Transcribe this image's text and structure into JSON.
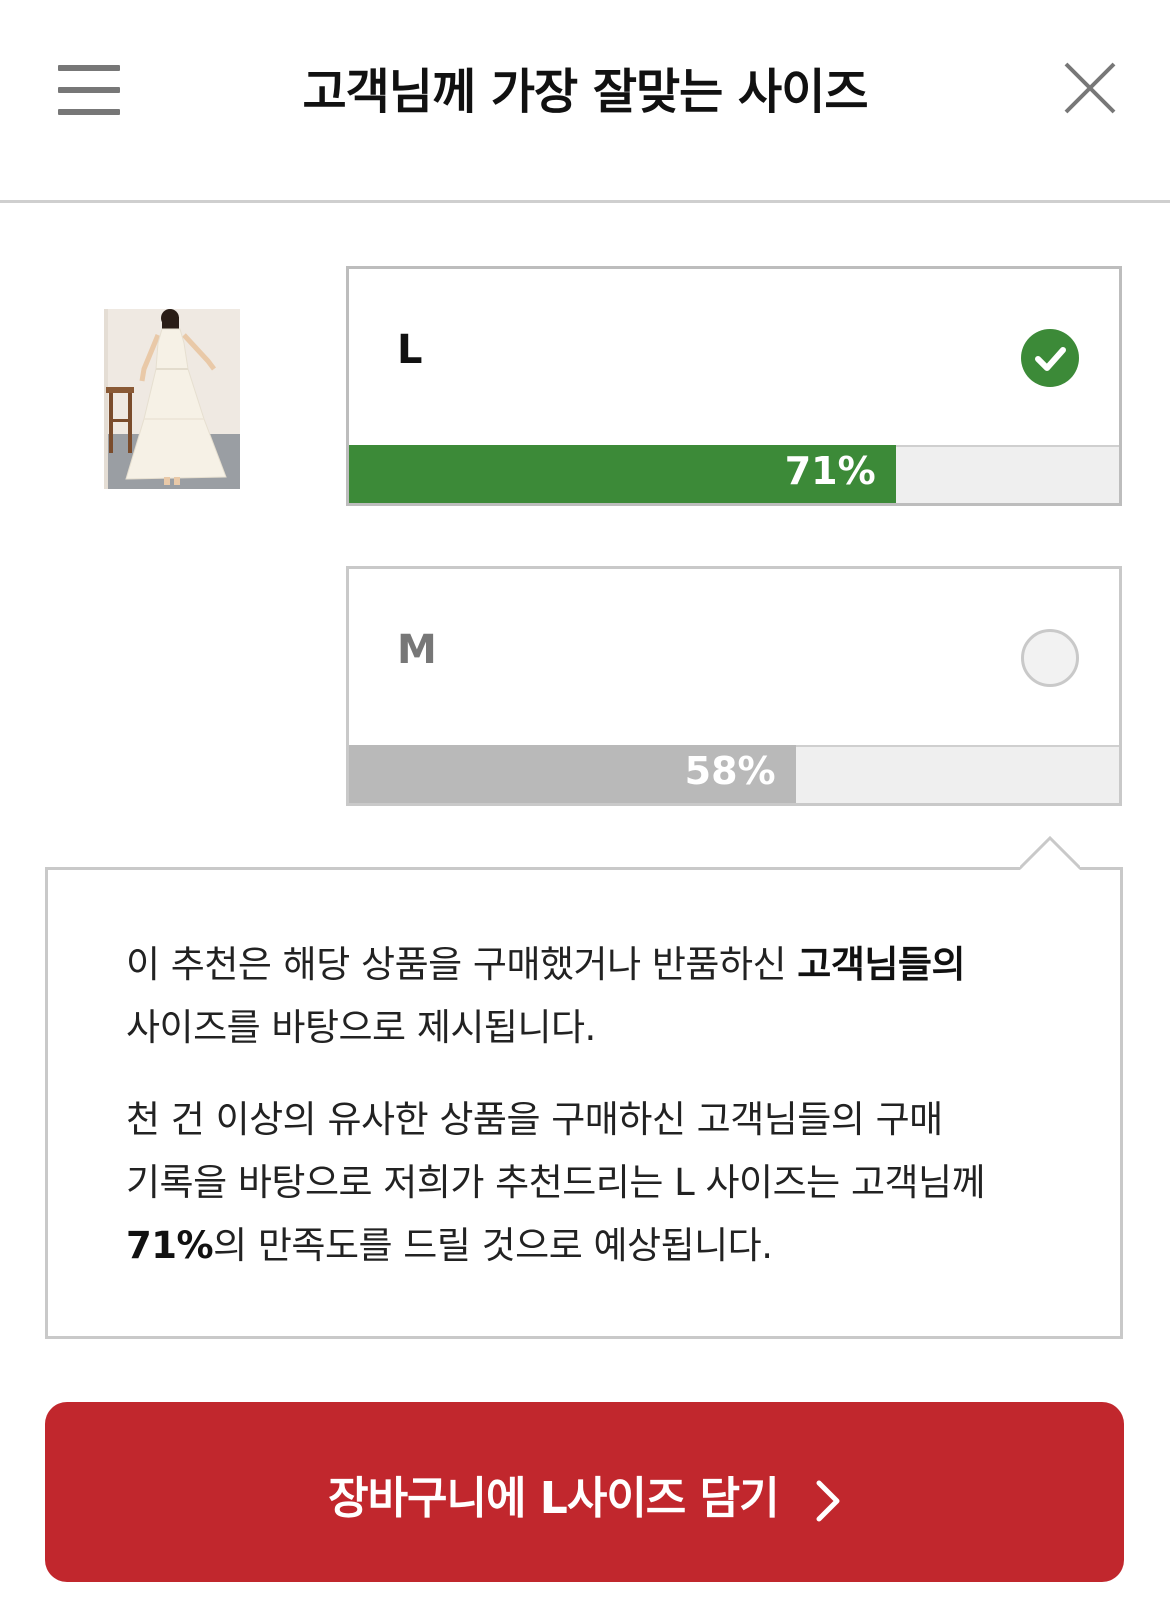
{
  "header": {
    "title": "고객님께 가장 잘맞는 사이즈",
    "menu_icon": "hamburger-menu-icon",
    "close_icon": "close-icon"
  },
  "product": {
    "image_alt": "white halter maxi dress"
  },
  "sizes": [
    {
      "label": "L",
      "percent_text": "71%",
      "percent": 0.71,
      "selected": true,
      "bar_color": "#3c8a38"
    },
    {
      "label": "M",
      "percent_text": "58%",
      "percent": 0.58,
      "selected": false,
      "bar_color": "#b9b9b9"
    }
  ],
  "info": {
    "p1_before": "이 추천은 해당 상품을 구매했거나 반품하신 ",
    "p1_bold": "고객님들의",
    "p1_after": "사이즈를 바탕으로 제시됩니다.",
    "p2_line1": "천 건 이상의 유사한 상품을 구매하신 고객님들의 구매",
    "p2_line2": "기록을 바탕으로 저희가 추천드리는 L 사이즈는 고객님께",
    "p2_bold": "71%",
    "p2_after": "의 만족도를 드릴 것으로 예상됩니다."
  },
  "cart_button": {
    "label": "장바구니에 L사이즈 담기"
  },
  "colors": {
    "accent_green": "#3c8a38",
    "cart_red": "#c1272d",
    "bar_gray": "#b9b9b9"
  }
}
